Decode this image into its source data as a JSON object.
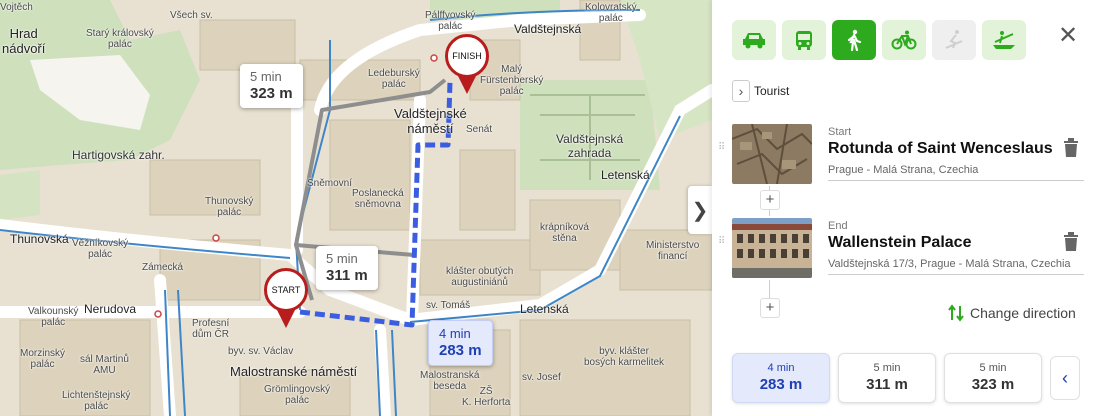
{
  "map": {
    "place_labels": [
      "Vojtěch",
      "Hrad\nnádvoří",
      "Starý královský\npalác",
      "Všech sv.",
      "Pálffyovský\npalác",
      "Kolovratský\npalác",
      "Valdštejnská",
      "Ledeburský\npalác",
      "Malý\nFürstenberský\npalác",
      "Valdštejnské\nnáměstí",
      "Senát",
      "Valdštejnská\nzahrada",
      "Hartigovská zahr.",
      "Sněmovní",
      "Poslanecká\nsněmovna",
      "Thunovský\npalác",
      "Thunovská",
      "Věžníkovský\npalác",
      "Zámecká",
      "Letenská",
      "krápníková\nstěna",
      "Ministerstvo\nfinancí",
      "klášter obutých\naugustiniánů",
      "sv. Tomáš",
      "Letenská",
      "Nerudova",
      "Valkounský\npalác",
      "Profesní\ndům ČR",
      "byv. sv. Václav",
      "Malostranské náměstí",
      "Morzinský\npalác",
      "sál Martinů\nAMU",
      "Lichtenštejnský\npalác",
      "Grömlingovský\npalác",
      "Malostranská\nbesedа",
      "sv. Josef",
      "byv. klášter\nbosých karmelitek",
      "ZŠ\nK. Herforta"
    ],
    "callouts": [
      {
        "time": "5 min",
        "distance": "323 m"
      },
      {
        "time": "5 min",
        "distance": "311 m"
      },
      {
        "time": "4 min",
        "distance": "283 m"
      }
    ],
    "start_pin": "START",
    "finish_pin": "FINISH"
  },
  "panel": {
    "modes": [
      "car-icon",
      "bus-icon",
      "walk-icon",
      "bike-icon",
      "ski-icon",
      "boat-icon"
    ],
    "active_mode": "walk-icon",
    "tourist_label": "Tourist",
    "start": {
      "kind": "Start",
      "name": "Rotunda of Saint Wenceslaus",
      "address": "Prague - Malá Strana, Czechia"
    },
    "end": {
      "kind": "End",
      "name": "Wallenstein Palace",
      "address": "Valdštejnská 17/3, Prague - Malá Strana, Czechia"
    },
    "change_direction": "Change direction",
    "routes": [
      {
        "time": "4 min",
        "distance": "283 m"
      },
      {
        "time": "5 min",
        "distance": "311 m"
      },
      {
        "time": "5 min",
        "distance": "323 m"
      }
    ],
    "colors": {
      "accent": "#2eaa1e",
      "route_active": "#1f3fb3",
      "pin": "#b81c1c"
    }
  }
}
